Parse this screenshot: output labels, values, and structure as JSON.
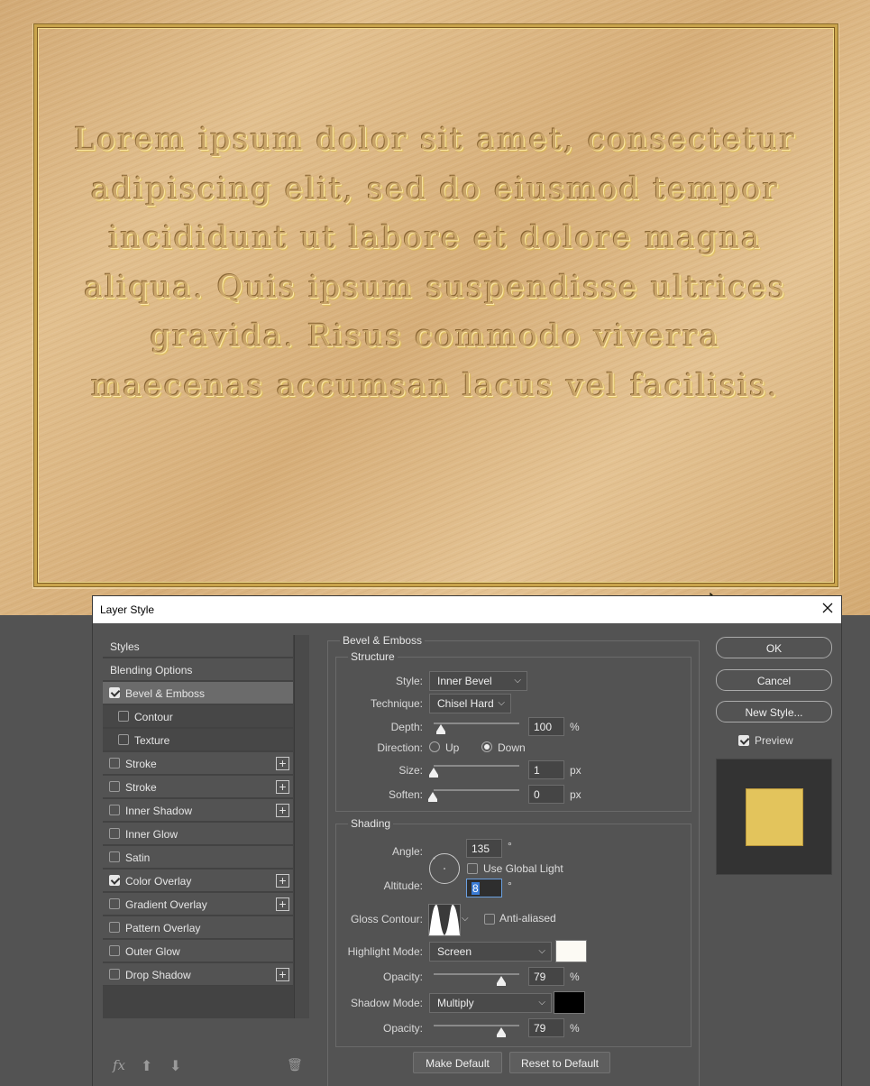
{
  "canvas": {
    "plate_text": "Lorem ipsum dolor sit amet, consectetur adipiscing elit, sed do eiusmod tempor incididunt ut labore et dolore magna aliqua. Quis ipsum suspendisse ultrices gravida. Risus commodo viverra maecenas accumsan lacus vel facilisis."
  },
  "dialog": {
    "title": "Layer Style",
    "close_icon": "close-icon"
  },
  "style_list": {
    "items": [
      {
        "label": "Styles"
      },
      {
        "label": "Blending Options"
      },
      {
        "label": "Bevel & Emboss",
        "checked": true,
        "selected": true
      },
      {
        "label": "Contour",
        "checked": false
      },
      {
        "label": "Texture",
        "checked": false
      },
      {
        "label": "Stroke",
        "checked": false,
        "plus": "+"
      },
      {
        "label": "Stroke",
        "checked": false,
        "plus": "+"
      },
      {
        "label": "Inner Shadow",
        "checked": false,
        "plus": "+"
      },
      {
        "label": "Inner Glow",
        "checked": false
      },
      {
        "label": "Satin",
        "checked": false
      },
      {
        "label": "Color Overlay",
        "checked": true,
        "plus": "+"
      },
      {
        "label": "Gradient Overlay",
        "checked": false,
        "plus": "+"
      },
      {
        "label": "Pattern Overlay",
        "checked": false
      },
      {
        "label": "Outer Glow",
        "checked": false
      },
      {
        "label": "Drop Shadow",
        "checked": false,
        "plus": "+"
      }
    ],
    "bottom_icons": {
      "fx": "fx",
      "up": "⬆",
      "down": "⬇",
      "trash": "🗑"
    }
  },
  "bevel": {
    "section_title": "Bevel & Emboss",
    "structure_title": "Structure",
    "style_label": "Style:",
    "style_value": "Inner Bevel",
    "technique_label": "Technique:",
    "technique_value": "Chisel Hard",
    "depth_label": "Depth:",
    "depth_value": "100",
    "depth_unit": "%",
    "direction_label": "Direction:",
    "direction_up": "Up",
    "direction_down": "Down",
    "size_label": "Size:",
    "size_value": "1",
    "size_unit": "px",
    "soften_label": "Soften:",
    "soften_value": "0",
    "soften_unit": "px"
  },
  "shading": {
    "title": "Shading",
    "angle_label": "Angle:",
    "angle_value": "135",
    "degree": "°",
    "use_global_light": "Use Global Light",
    "altitude_label": "Altitude:",
    "altitude_value": "8",
    "gloss_contour_label": "Gloss Contour:",
    "anti_aliased": "Anti-aliased",
    "highlight_mode_label": "Highlight Mode:",
    "highlight_mode_value": "Screen",
    "highlight_color": "#fcfaf4",
    "opacity_label": "Opacity:",
    "highlight_opacity": "79",
    "shadow_mode_label": "Shadow Mode:",
    "shadow_mode_value": "Multiply",
    "shadow_color": "#000000",
    "shadow_opacity": "79",
    "percent": "%",
    "make_default": "Make Default",
    "reset_default": "Reset to Default"
  },
  "right": {
    "ok": "OK",
    "cancel": "Cancel",
    "new_style": "New Style...",
    "preview_label": "Preview",
    "preview_color": "#e3c45c"
  }
}
